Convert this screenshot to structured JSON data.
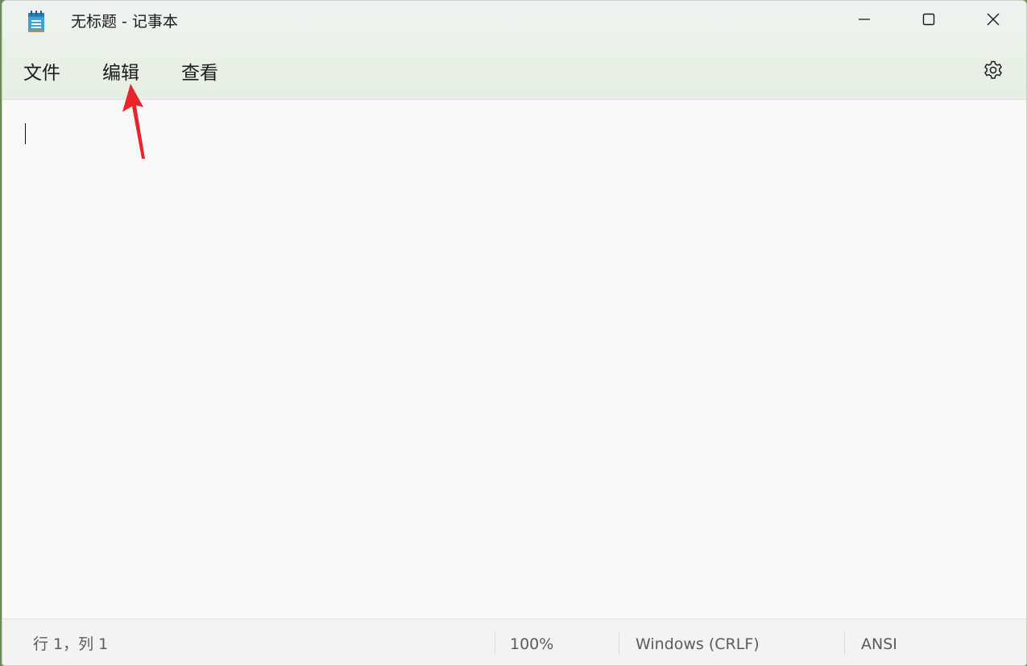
{
  "window": {
    "title": "无标题 - 记事本",
    "icons": {
      "app": "notepad-icon",
      "minimize": "minimize-icon",
      "maximize": "maximize-icon",
      "close": "close-icon",
      "settings": "gear-icon"
    }
  },
  "menu": {
    "file": "文件",
    "edit": "编辑",
    "view": "查看"
  },
  "editor": {
    "content": ""
  },
  "status": {
    "position": "行 1，列 1",
    "zoom": "100%",
    "line_ending": "Windows (CRLF)",
    "encoding": "ANSI"
  },
  "annotation": {
    "arrow_color": "#e8252d"
  }
}
